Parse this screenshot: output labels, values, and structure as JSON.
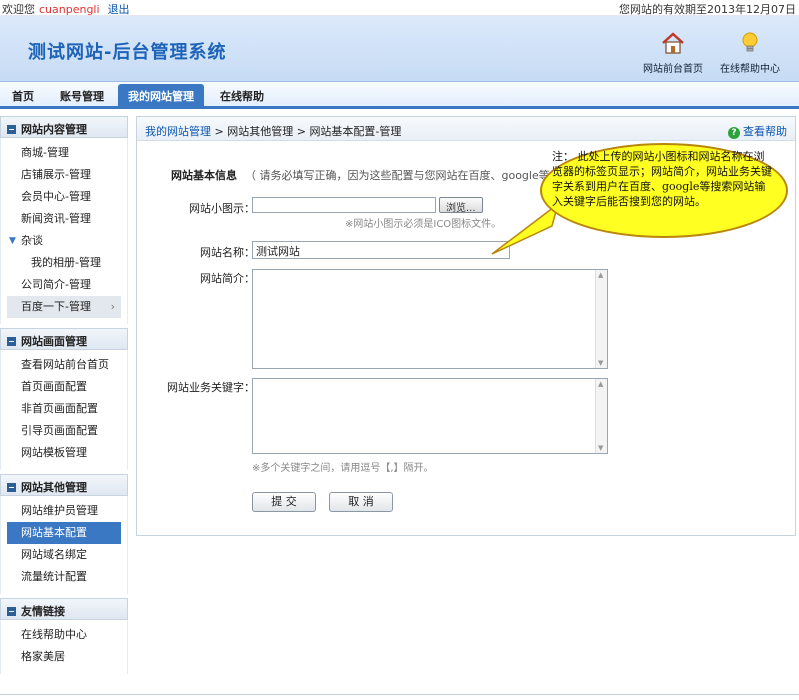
{
  "topbar": {
    "welcome": "欢迎您",
    "username": "cuanpengli",
    "logout": "退出",
    "expiry": "您网站的有效期至2013年12月07日"
  },
  "header": {
    "title": "测试网站-后台管理系统",
    "front_home": "网站前台首页",
    "online_help": "在线帮助中心"
  },
  "nav": {
    "tabs": [
      {
        "label": "首页"
      },
      {
        "label": "账号管理"
      },
      {
        "label": "我的网站管理",
        "active": true
      },
      {
        "label": "在线帮助"
      }
    ]
  },
  "sidebar": {
    "sections": [
      {
        "title": "网站内容管理",
        "items": [
          "商城-管理",
          "店铺展示-管理",
          "会员中心-管理",
          "新闻资讯-管理",
          "杂谈",
          "我的相册-管理",
          "公司简介-管理",
          "百度一下-管理"
        ]
      },
      {
        "title": "网站画面管理",
        "items": [
          "查看网站前台首页",
          "首页画面配置",
          "非首页画面配置",
          "引导页画面配置",
          "网站模板管理"
        ]
      },
      {
        "title": "网站其他管理",
        "items": [
          "网站维护员管理",
          "网站基本配置",
          "网站域名绑定",
          "流量统计配置"
        ]
      },
      {
        "title": "友情链接",
        "items": [
          "在线帮助中心",
          "格家美居"
        ]
      }
    ]
  },
  "breadcrumb": {
    "home": "我的网站管理",
    "sep1": " > ",
    "level2": "网站其他管理",
    "sep2": " > ",
    "current": "网站基本配置-管理",
    "help": "查看帮助"
  },
  "form": {
    "section_title": "网站基本信息",
    "section_note": "（ 请务必填写正确，因为这些配置与您网站在百度、google等",
    "icon_label": "网站小图示：",
    "browse": "浏览...",
    "icon_hint": "※网站小图示必须是ICO图标文件。",
    "name_label": "网站名称：",
    "name_value": "测试网站",
    "intro_label": "网站简介：",
    "keywords_label": "网站业务关键字：",
    "keywords_hint": "※多个关键字之间，请用逗号【,】隔开。",
    "submit": "提 交",
    "cancel": "取 消"
  },
  "callout": {
    "text": "注：  此处上传的网站小图标和网站名称在浏览器的标签页显示；网站简介，网站业务关键字关系到用户在百度、google等搜索网站输入关键字后能否搜到您的网站。"
  },
  "colors": {
    "accent": "#3a78c4",
    "title": "#1d63b8",
    "callout_fill": "#ffff22",
    "callout_border": "#b8860b"
  },
  "icons": {
    "home": "house-icon",
    "help": "lightbulb-icon",
    "question": "question-circle-icon"
  }
}
